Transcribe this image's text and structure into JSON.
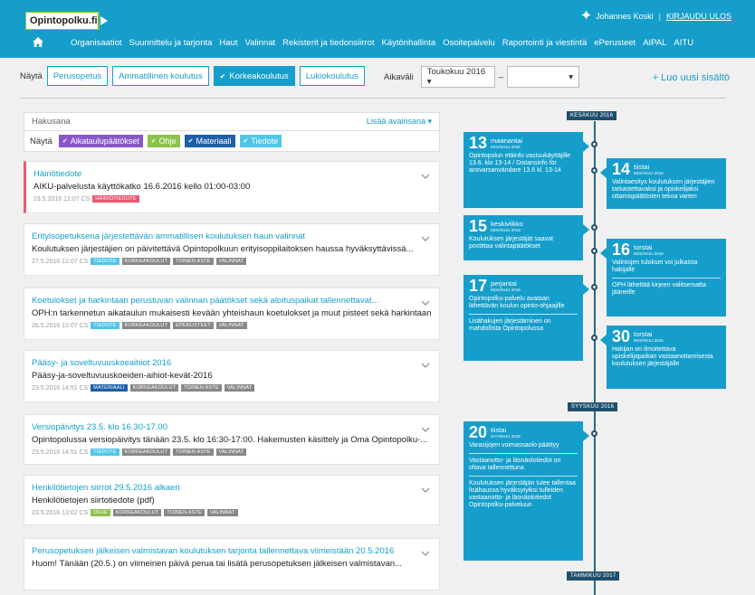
{
  "header": {
    "logo_text": "Opintopolku.fi",
    "user_name": "Johannes Koski",
    "separator": "|",
    "logout": "KIRJAUDU ULOS",
    "nav": [
      "Organisaatiot",
      "Suunnittelu ja tarjonta",
      "Haut",
      "Valinnat",
      "Rekisterit ja tiedonsiirrot",
      "Käytönhallinta",
      "Osoitepalvelu",
      "Raportointi ja viestintä",
      "ePerusteet",
      "AIPAL",
      "AITU"
    ]
  },
  "filters": {
    "show_label": "Näytä",
    "buttons": [
      {
        "label": "Perusopetus",
        "active": false
      },
      {
        "label": "Ammatillinen koulutus",
        "active": false
      },
      {
        "label": "Korkeakoulutus",
        "active": true
      },
      {
        "label": "Lukiokoulutus",
        "active": false
      }
    ],
    "period_label": "Aikaväli",
    "period_from": "Toukokuu 2016 ▾",
    "period_dash": "–",
    "period_to": "",
    "add_new": "+ Luo uusi sisältö"
  },
  "search": {
    "placeholder": "Hakusana",
    "more_keywords": "Lisää avainsana ▾",
    "show_label": "Näytä",
    "types": [
      {
        "label": "Aikataulupäätökset",
        "color": "#8a56c9"
      },
      {
        "label": "Ohje",
        "color": "#8bc34a"
      },
      {
        "label": "Materiaali",
        "color": "#1f5fa8"
      },
      {
        "label": "Tiedote",
        "color": "#4ec6e8"
      }
    ]
  },
  "news": [
    {
      "title": "Häiriötiedote",
      "body": "AIKU-palvelusta käyttökatko 16.6.2016 kello 01:00-03:00",
      "date": "23.5.2016 12:07 CS",
      "tags": [
        {
          "t": "HÄIRIÖTIEDOTE",
          "c": "#e85a70"
        }
      ],
      "alert": true
    },
    {
      "title": "Erityisopetuksena järjestettävän ammatillisen koulutuksen haun valinnat",
      "body": "Koulutuksen järjestäjien on päivitettävä Opintopolkuun erityisoppilaitoksen haussa hyväksyttävissä...",
      "date": "27.5.2016 12:07 CS",
      "tags": [
        {
          "t": "TIEDOTE",
          "c": "#4ec6e8"
        },
        {
          "t": "KORKEAKOULUT",
          "c": "#888"
        },
        {
          "t": "TOINEN ASTE",
          "c": "#888"
        },
        {
          "t": "VALINNAT",
          "c": "#888"
        }
      ],
      "alert": false
    },
    {
      "title": "Koetulokset ja harkintaan perustuvan valinnan päätökset sekä aloituspaikat tallennettavat...",
      "body": "OPH:n tarkennetun aikataulun mukaisesti kevään yhteishaun koetulokset ja muut pisteet sekä harkintaan...",
      "date": "26.5.2016 12:07 CS",
      "tags": [
        {
          "t": "TIEDOTE",
          "c": "#4ec6e8"
        },
        {
          "t": "KORKEAKOULUT",
          "c": "#888"
        },
        {
          "t": "ePERUSTEET",
          "c": "#888"
        },
        {
          "t": "VALINNAT",
          "c": "#888"
        }
      ],
      "alert": false
    },
    {
      "title": "Pääsy- ja soveltuvuuskoeaihiot 2016",
      "body": "Pääsy-ja-soveltuvuuskoeiden-aihiot-kevät-2016",
      "date": "23.5.2016 14:51 CS",
      "tags": [
        {
          "t": "MATERIAALI",
          "c": "#1f5fa8"
        },
        {
          "t": "KORKEAKOULUT",
          "c": "#888"
        },
        {
          "t": "TOINEN ASTE",
          "c": "#888"
        },
        {
          "t": "VALINNAT",
          "c": "#888"
        }
      ],
      "alert": false
    },
    {
      "title": "Versiopäivitys 23.5. klo 16.30-17.00",
      "body": "Opintopolussa versiopäivitys tänään 23.5. klo 16:30-17:00. Hakemusten käsittely ja Oma Opintopolku-...",
      "date": "23.5.2016 14:51 CS",
      "tags": [
        {
          "t": "TIEDOTE",
          "c": "#4ec6e8"
        },
        {
          "t": "KORKEAKOULUT",
          "c": "#888"
        },
        {
          "t": "TOINEN ASTE",
          "c": "#888"
        },
        {
          "t": "VALINNAT",
          "c": "#888"
        }
      ],
      "alert": false
    },
    {
      "title": "Henkilötietojen siirrot 29.5.2016 alkaen",
      "body": "Henkilötietojen siirtotiedote (pdf)",
      "date": "23.5.2016 13:02 CS",
      "tags": [
        {
          "t": "OHJE",
          "c": "#8bc34a"
        },
        {
          "t": "KORKEAKOULUT",
          "c": "#888"
        },
        {
          "t": "TOINEN ASTE",
          "c": "#888"
        },
        {
          "t": "VALINNAT",
          "c": "#888"
        }
      ],
      "alert": false
    },
    {
      "title": "Perusopetuksen jälkeisen valmistavan koulutuksen tarjonta tallennettava viimeistään 20.5.2016",
      "body": "Huom! Tänään (20.5.) on viimeinen päivä perua tai lisätä perusopetuksen jälkeisen valmistavan...",
      "date": "",
      "tags": [],
      "alert": false
    }
  ],
  "timeline": {
    "months": [
      "KESÄKUU 2016",
      "SYYSKUU 2016",
      "TAMMIKUU 2017"
    ],
    "events": [
      {
        "day": "13",
        "weekday": "maanantai",
        "month": "KESÄKUU 2016",
        "items": [
          "Opintopolun etäinfo vastuukäyttäjille 13.6. klo 13-14 / Distansinfo för ansvarsanvändare 13.6 kl. 13-14"
        ]
      },
      {
        "day": "14",
        "weekday": "tiistai",
        "month": "KESÄKUU 2016",
        "items": [
          "Valintaesitys koulutuksen järjestäjien tarkastettavaksi ja opiskelijaksi ottamispäätösten tekoa varten"
        ]
      },
      {
        "day": "15",
        "weekday": "keskiviikko",
        "month": "KESÄKUU 2016",
        "items": [
          "Koulutuksen järjestäjät saavat postittaa valintapäätökset"
        ]
      },
      {
        "day": "16",
        "weekday": "torstai",
        "month": "KESÄKUU 2016",
        "items": [
          "Valintojen tulokset voi julkaista hakijalle",
          "OPH lähettää kirjeen valitsematta jääneille"
        ]
      },
      {
        "day": "17",
        "weekday": "perjantai",
        "month": "KESÄKUU 2016",
        "items": [
          "Opintopolku-palvelu avataan lähettävän koulun opinto-ohjaajille",
          "Lisähakujen järjestäminen on mahdollista Opintopolussa"
        ]
      },
      {
        "day": "30",
        "weekday": "torstai",
        "month": "KESÄKUU 2016",
        "items": [
          "Hakijan on ilmoitettava opiskelijapaikan vastaanottamisesta koulutuksen järjestäjälle"
        ]
      },
      {
        "day": "20",
        "weekday": "tiistai",
        "month": "SYYSKUU 2016",
        "items": [
          "Varasijojen voimassaolo päättyy",
          "Vastaanotto- ja läsnäolotiedot on oltava tallennettuna",
          "Koulutuksen järjestäjän tulee tallentaa lisähaussa hyväksytyiksi tulleiden vastaanotto- ja läsnäolotiedot Opintopolku-palveluun"
        ]
      }
    ]
  }
}
